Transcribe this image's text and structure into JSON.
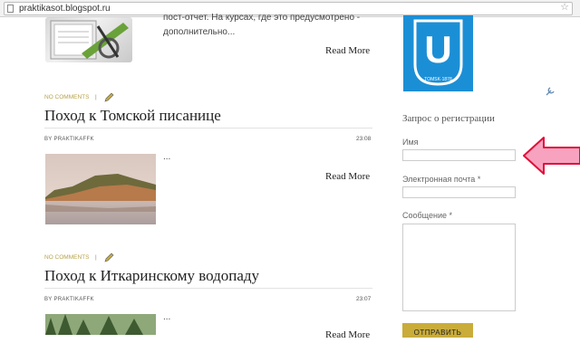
{
  "browser": {
    "url": "praktikasot.blogspot.ru",
    "star_glyph": "☆"
  },
  "top_post": {
    "excerpt_line1": "пост-отчет. На курсах, где это предусмотрено -",
    "excerpt_line2": "дополнительно...",
    "read_more": "Read More"
  },
  "posts": [
    {
      "no_comments": "NO COMMENTS",
      "separator": "|",
      "title": "Поход к Томской писанице",
      "by": "BY PRAKTIKAFFK",
      "time": "23:08",
      "excerpt": "...",
      "read_more": "Read More"
    },
    {
      "no_comments": "NO COMMENTS",
      "separator": "|",
      "title": "Поход к Иткаринскому водопаду",
      "by": "BY PRAKTIKAFFK",
      "time": "23:07",
      "excerpt": "...",
      "read_more": "Read More"
    }
  ],
  "sidebar": {
    "logo": {
      "letter": "U",
      "caption": "TOMSK·1878",
      "color": "#1b8fd6"
    },
    "form_title": "Запрос о регистрации",
    "name_label": "Имя",
    "email_label": "Электронная почта *",
    "message_label": "Сообщение *",
    "submit_label": "ОТПРАВИТЬ",
    "accent_color": "#c9ac3a"
  },
  "annotation": {
    "arrow_color": "#f7a3bf"
  },
  "icons": [
    "page-icon",
    "star-icon",
    "pencil-icon",
    "wrench-icon",
    "arrow-annotation"
  ]
}
